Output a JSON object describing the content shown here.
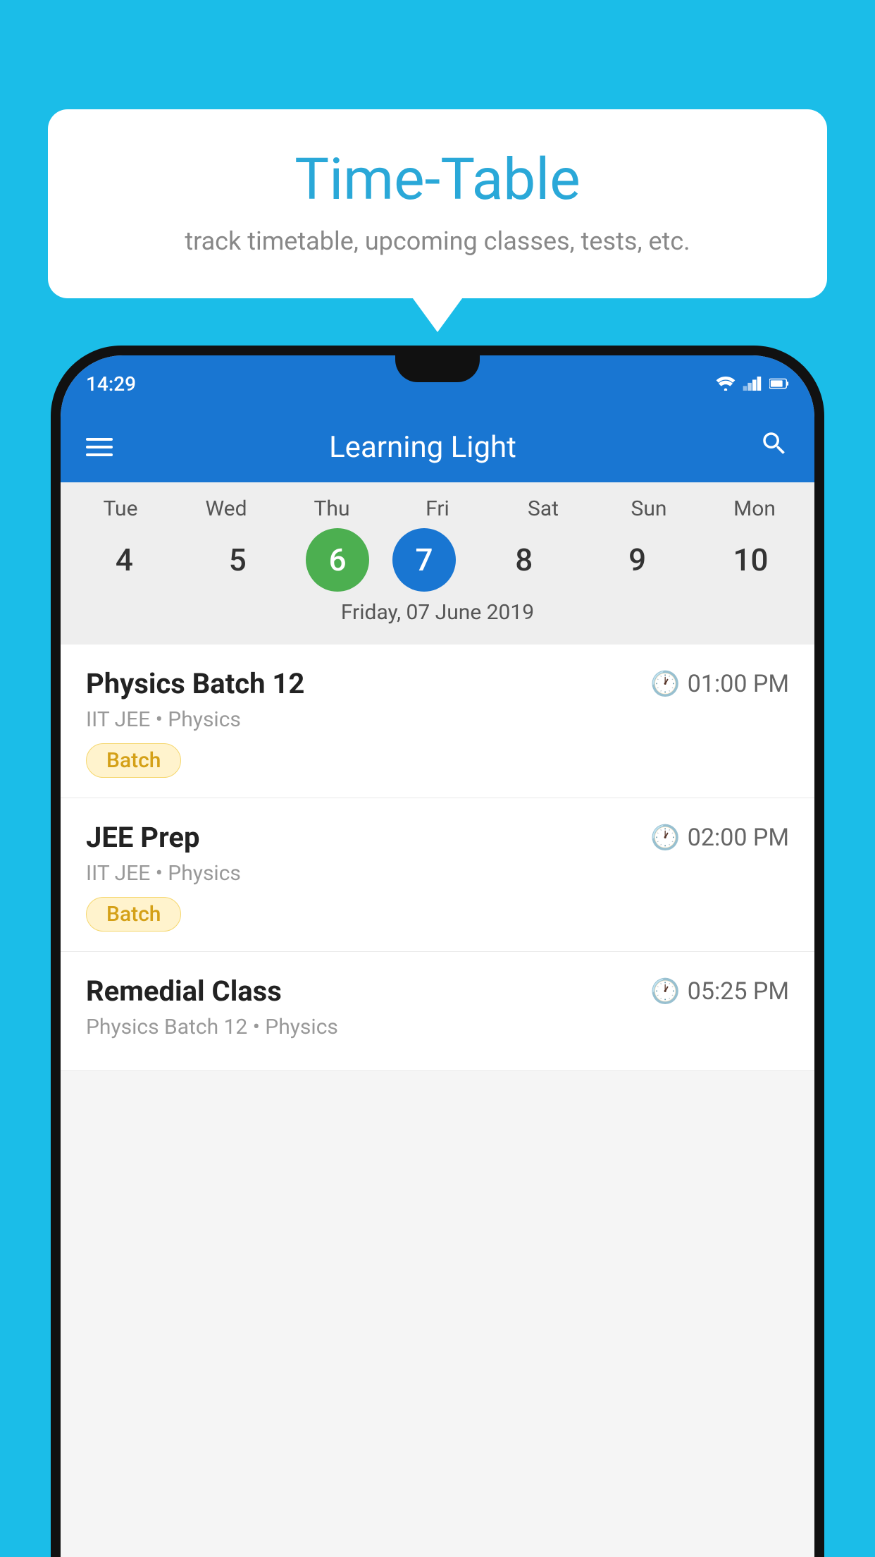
{
  "background_color": "#1BBDE8",
  "tooltip": {
    "title": "Time-Table",
    "subtitle": "track timetable, upcoming classes, tests, etc."
  },
  "phone": {
    "status_bar": {
      "time": "14:29"
    },
    "app_bar": {
      "title": "Learning Light",
      "menu_icon": "hamburger-icon",
      "search_icon": "search-icon"
    },
    "calendar": {
      "days": [
        {
          "label": "Tue",
          "number": "4"
        },
        {
          "label": "Wed",
          "number": "5"
        },
        {
          "label": "Thu",
          "number": "6",
          "state": "today"
        },
        {
          "label": "Fri",
          "number": "7",
          "state": "selected"
        },
        {
          "label": "Sat",
          "number": "8"
        },
        {
          "label": "Sun",
          "number": "9"
        },
        {
          "label": "Mon",
          "number": "10"
        }
      ],
      "selected_date_label": "Friday, 07 June 2019"
    },
    "schedule": [
      {
        "title": "Physics Batch 12",
        "time": "01:00 PM",
        "subtitle": "IIT JEE • Physics",
        "badge": "Batch"
      },
      {
        "title": "JEE Prep",
        "time": "02:00 PM",
        "subtitle": "IIT JEE • Physics",
        "badge": "Batch"
      },
      {
        "title": "Remedial Class",
        "time": "05:25 PM",
        "subtitle": "Physics Batch 12 • Physics",
        "badge": null
      }
    ]
  }
}
